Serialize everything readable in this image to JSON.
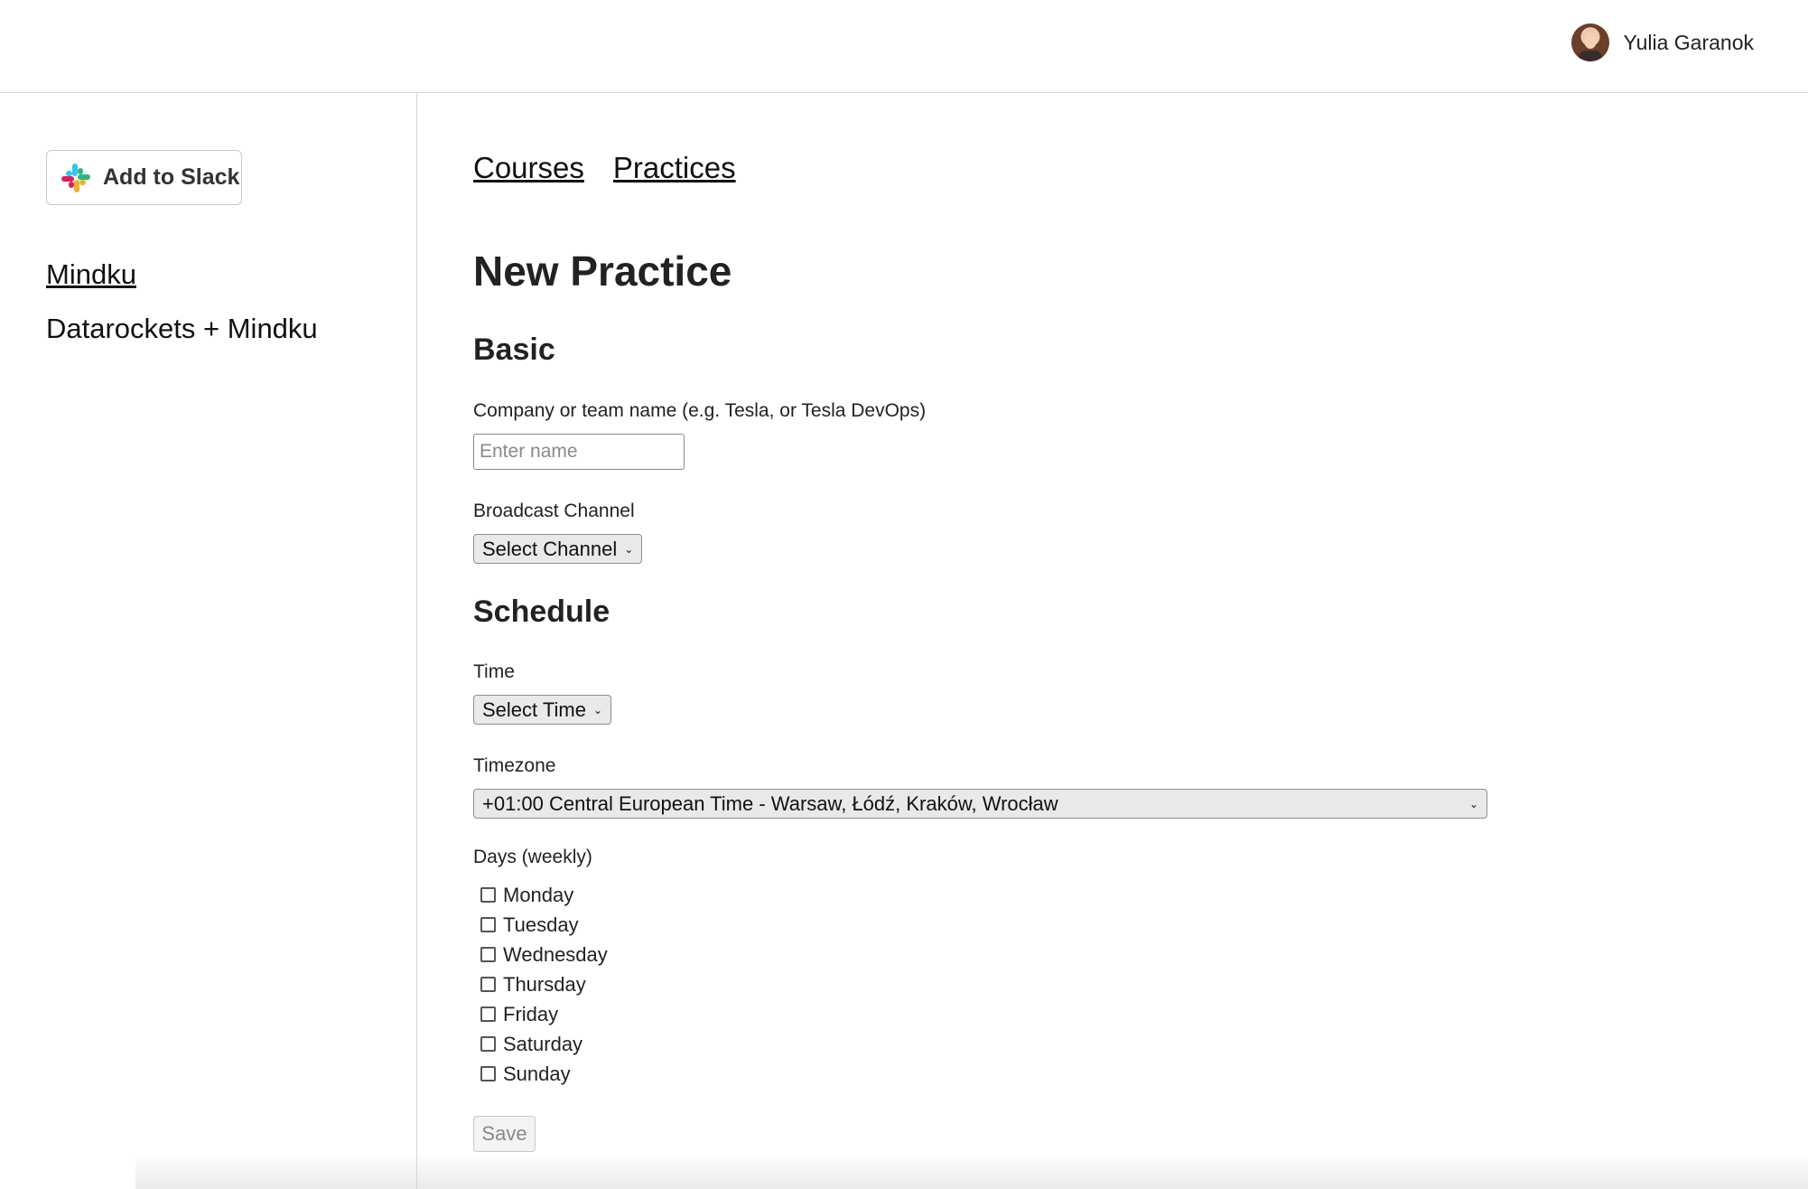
{
  "header": {
    "user_name": "Yulia Garanok"
  },
  "sidebar": {
    "slack_button": {
      "prefix": "Add to ",
      "suffix": "Slack"
    },
    "items": [
      {
        "label": "Mindku",
        "active": true
      },
      {
        "label": "Datarockets + Mindku",
        "active": false
      }
    ]
  },
  "nav": {
    "courses": "Courses",
    "practices": "Practices"
  },
  "form": {
    "title": "New Practice",
    "basic_heading": "Basic",
    "name_label": "Company or team name (e.g. Tesla, or Tesla DevOps)",
    "name_placeholder": "Enter name",
    "name_value": "",
    "channel_label": "Broadcast Channel",
    "channel_value": "Select Channel",
    "schedule_heading": "Schedule",
    "time_label": "Time",
    "time_value": "Select Time",
    "timezone_label": "Timezone",
    "timezone_value": "+01:00 Central European Time - Warsaw, Łódź, Kraków, Wrocław",
    "days_label": "Days (weekly)",
    "days": [
      {
        "label": "Monday",
        "checked": false
      },
      {
        "label": "Tuesday",
        "checked": false
      },
      {
        "label": "Wednesday",
        "checked": false
      },
      {
        "label": "Thursday",
        "checked": false
      },
      {
        "label": "Friday",
        "checked": false
      },
      {
        "label": "Saturday",
        "checked": false
      },
      {
        "label": "Sunday",
        "checked": false
      }
    ],
    "save_label": "Save"
  },
  "colors": {
    "slack_red": "#E01E5A",
    "slack_green": "#2EB67D",
    "slack_blue": "#36C5F0",
    "slack_yellow": "#ECB22E"
  }
}
